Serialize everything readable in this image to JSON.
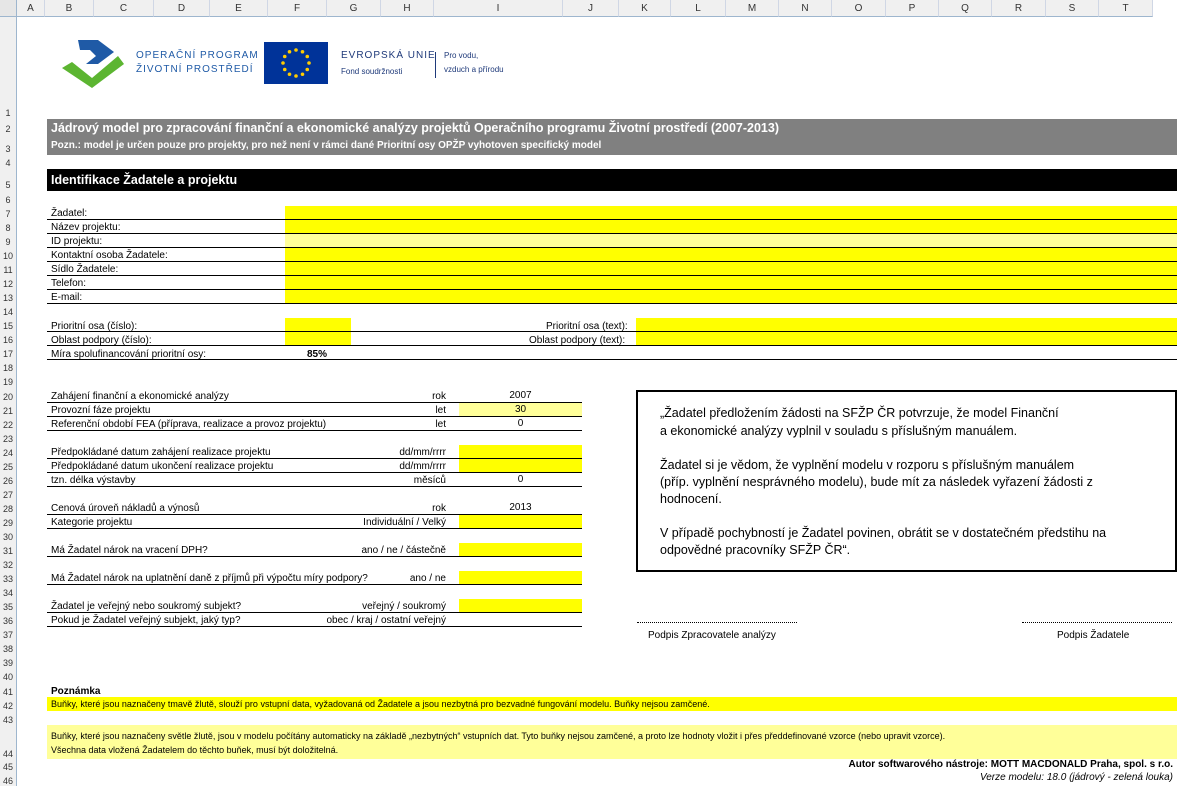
{
  "columns": [
    "A",
    "B",
    "C",
    "D",
    "E",
    "F",
    "G",
    "H",
    "I",
    "J",
    "K",
    "L",
    "M",
    "N",
    "O",
    "P",
    "Q",
    "R",
    "S",
    "T"
  ],
  "rows": [
    "1",
    "2",
    "3",
    "4",
    "5",
    "6",
    "7",
    "8",
    "9",
    "10",
    "11",
    "12",
    "13",
    "14",
    "15",
    "16",
    "17",
    "18",
    "19",
    "20",
    "21",
    "22",
    "23",
    "24",
    "25",
    "26",
    "27",
    "28",
    "29",
    "30",
    "31",
    "32",
    "33",
    "34",
    "35",
    "36",
    "37",
    "38",
    "39",
    "40",
    "41",
    "42",
    "43",
    "44",
    "45",
    "46"
  ],
  "logo": {
    "op_line1": "OPERAČNÍ PROGRAM",
    "op_line2": "ŽIVOTNÍ PROSTŘEDÍ",
    "eu_line1": "EVROPSKÁ UNIE",
    "eu_line2": "Fond soudržnosti",
    "motto_line1": "Pro vodu,",
    "motto_line2": "vzduch a přírodu"
  },
  "title": "Jádrový model pro zpracování finanční a ekonomické analýzy projektů Operačního programu Životní prostředí (2007-2013)",
  "subtitle": "Pozn.: model je určen pouze pro projekty, pro než není v rámci dané Prioritní osy OPŽP vyhotoven specifický model",
  "section_header": "Identifikace Žadatele a projektu",
  "ident": {
    "applicant": "Žadatel:",
    "project_name": "Název projektu:",
    "project_id": "ID projektu:",
    "contact": "Kontaktní osoba Žadatele:",
    "seat": "Sídlo Žadatele:",
    "phone": "Telefon:",
    "email": "E-mail:"
  },
  "priority": {
    "axis_num": "Prioritní osa (číslo):",
    "area_num": "Oblast podpory (číslo):",
    "cofin": "Míra spolufinancování prioritní osy:",
    "cofin_value": "85%",
    "axis_text": "Prioritní osa (text):",
    "area_text": "Oblast podpory (text):"
  },
  "params": [
    {
      "label": "Zahájení finanční a ekonomické analýzy",
      "unit": "rok",
      "value": "2007"
    },
    {
      "label": "Provozní fáze projektu",
      "unit": "let",
      "value": "30"
    },
    {
      "label": "Referenční období FEA (příprava, realizace a provoz projektu)",
      "unit": "let",
      "value": "0"
    },
    {
      "label": "Předpokládané datum zahájení realizace projektu",
      "unit": "dd/mm/rrrr",
      "value": ""
    },
    {
      "label": "Předpokládané datum ukončení realizace projektu",
      "unit": "dd/mm/rrrr",
      "value": ""
    },
    {
      "label": "tzn. délka výstavby",
      "unit": "měsíců",
      "value": "0"
    },
    {
      "label": "Cenová úroveň nákladů a výnosů",
      "unit": "rok",
      "value": "2013"
    },
    {
      "label": "Kategorie projektu",
      "unit": "Individuální / Velký",
      "value": ""
    },
    {
      "label": "Má Žadatel nárok na vracení DPH?",
      "unit": "ano / ne / částečně",
      "value": ""
    },
    {
      "label": "Má Žadatel nárok na uplatnění daně z příjmů při výpočtu míry podpory?",
      "unit": "ano / ne",
      "value": ""
    },
    {
      "label": "Žadatel je veřejný nebo soukromý subjekt?",
      "unit": "veřejný / soukromý",
      "value": ""
    },
    {
      "label": "Pokud je Žadatel veřejný subjekt, jaký typ?",
      "unit": "obec / kraj / ostatní veřejný",
      "value": ""
    }
  ],
  "declaration": {
    "p1a": "„Žadatel předložením žádosti na SFŽP ČR potvrzuje, že model Finanční",
    "p1b": "a ekonomické analýzy vyplnil v souladu s příslušným manuálem.",
    "p2a": " Žadatel si je vědom, že vyplnění modelu v rozporu s příslušným manuálem",
    "p2b": "(příp. vyplnění nesprávného modelu), bude mít za následek vyřazení žádosti z",
    "p2c": "hodnocení.",
    "p3a": "V případě pochybností je Žadatel povinen, obrátit se v dostatečném předstihu na",
    "p3b": "odpovědné pracovníky SFŽP ČR“."
  },
  "signatures": {
    "analyst": "Podpis Zpracovatele analýzy",
    "applicant": "Podpis Žadatele"
  },
  "notes": {
    "heading": "Poznámka",
    "dark_yellow": "Buňky, které jsou naznačeny tmavě žlutě, slouží pro vstupní data, vyžadovaná od Žadatele a jsou nezbytná pro bezvadné fungování modelu. Buňky nejsou zamčené.",
    "light_yellow_1": "Buňky, které jsou naznačeny světle žlutě, jsou v modelu počítány automaticky na základě „nezbytných“ vstupních dat. Tyto buňky nejsou zamčené, a proto lze hodnoty vložit i přes předdefinované vzorce (nebo upravit vzorce).",
    "light_yellow_2": "Všechna data vložená Žadatelem do těchto buňek, musí být doložitelná."
  },
  "footer": {
    "author": "Autor softwarového nástroje: MOTT MACDONALD Praha, spol. s r.o.",
    "version": "Verze modelu: 18.0 (jádrový - zelená louka)"
  },
  "colors": {
    "dark_yellow": "#ffff00",
    "light_yellow": "#ffff99",
    "title_bar": "#808080",
    "section_bar": "#000000",
    "op_green": "#5cb531",
    "op_blue": "#1f5aa6",
    "eu_blue": "#003399",
    "eu_star": "#ffcc00"
  }
}
